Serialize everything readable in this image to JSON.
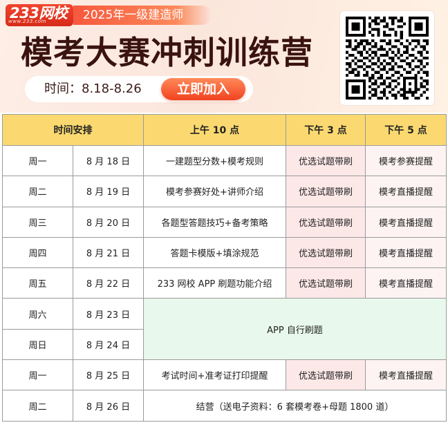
{
  "banner": {
    "logo_text": "233网校",
    "logo_url": "www.233.com",
    "badge": "2025年一级建造师",
    "headline": "模考大赛冲刺训练营",
    "time_label": "时间：8.18-8.26",
    "join_button": "立即加入"
  },
  "table": {
    "headers": {
      "schedule": "时间安排",
      "am10": "上午 10 点",
      "pm3": "下午 3 点",
      "pm5": "下午 5 点"
    },
    "rows": [
      {
        "day": "周一",
        "date": "8 月 18 日",
        "am10": "一建题型分数+模考规则",
        "pm3": "优选试题带刷",
        "pm5": "模考参赛提醒"
      },
      {
        "day": "周二",
        "date": "8 月 19 日",
        "am10": "模考参赛好处+讲师介绍",
        "pm3": "优选试题带刷",
        "pm5": "模考直播提醒"
      },
      {
        "day": "周三",
        "date": "8 月 20 日",
        "am10": "各题型答题技巧+备考策略",
        "pm3": "优选试题带刷",
        "pm5": "模考直播提醒"
      },
      {
        "day": "周四",
        "date": "8 月 21 日",
        "am10": "答题卡模版+填涂规范",
        "pm3": "优选试题带刷",
        "pm5": "模考直播提醒"
      },
      {
        "day": "周五",
        "date": "8 月 22 日",
        "am10": "233 网校 APP 刷题功能介绍",
        "pm3": "优选试题带刷",
        "pm5": "模考直播提醒"
      },
      {
        "day": "周六",
        "date": "8 月 23 日"
      },
      {
        "day": "周日",
        "date": "8 月 24 日"
      },
      {
        "day": "周一",
        "date": "8 月 25 日",
        "am10": "考试时间+准考证打印提醒",
        "pm3": "优选试题带刷",
        "pm5": "模考直播提醒"
      },
      {
        "day": "周二",
        "date": "8 月 26 日"
      }
    ],
    "weekend_text": "APP 自行刷题",
    "camp_text": "结营（送电子资料：6 套模考卷+母题 1800 道）"
  },
  "colors": {
    "header_bg": "#fbd970",
    "pm3_bg": "#fde8e8",
    "weekend_bg": "#e9f8ec",
    "camp_text": "#e0201a",
    "brand_red": "#e43a22"
  }
}
